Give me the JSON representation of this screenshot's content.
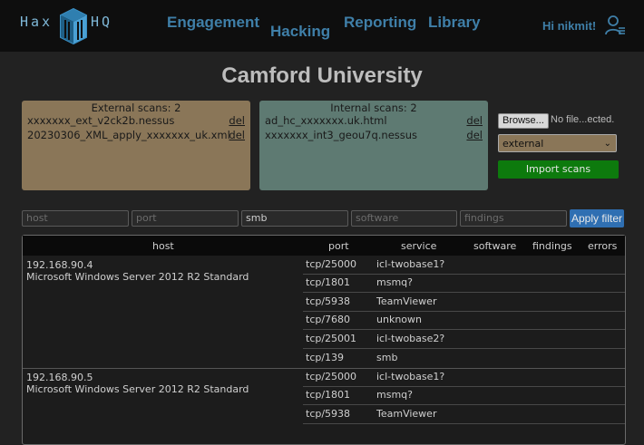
{
  "logo": {
    "left": "Hax",
    "right": "HQ"
  },
  "nav": {
    "engagement": "Engagement",
    "hacking": "Hacking",
    "reporting": "Reporting",
    "library": "Library"
  },
  "user": {
    "greeting": "Hi nikmit!"
  },
  "page": {
    "title": "Camford University"
  },
  "external_scans": {
    "header": "External scans: 2",
    "items": [
      {
        "name": "xxxxxxx_ext_v2ck2b.nessus",
        "del": "del"
      },
      {
        "name": "20230306_XML_apply_xxxxxxx_uk.xml",
        "del": "del"
      }
    ]
  },
  "internal_scans": {
    "header": "Internal scans: 2",
    "items": [
      {
        "name": "ad_hc_xxxxxxx.uk.html",
        "del": "del"
      },
      {
        "name": "xxxxxxx_int3_geou7q.nessus",
        "del": "del"
      }
    ]
  },
  "upload": {
    "browse": "Browse...",
    "no_file": "No file...ected.",
    "scan_type": "external",
    "import": "Import scans"
  },
  "filters": {
    "host_placeholder": "host",
    "port_placeholder": "port",
    "service_value": "smb",
    "software_placeholder": "software",
    "findings_placeholder": "findings",
    "apply": "Apply filter"
  },
  "table": {
    "headers": {
      "host": "host",
      "port": "port",
      "service": "service",
      "software": "software",
      "findings": "findings",
      "errors": "errors"
    },
    "hosts": [
      {
        "ip": "192.168.90.4",
        "os": "Microsoft Windows Server 2012 R2 Standard",
        "services": [
          {
            "port": "tcp/25000",
            "service": "icl-twobase1?"
          },
          {
            "port": "tcp/1801",
            "service": "msmq?"
          },
          {
            "port": "tcp/5938",
            "service": "TeamViewer"
          },
          {
            "port": "tcp/7680",
            "service": "unknown"
          },
          {
            "port": "tcp/25001",
            "service": "icl-twobase2?"
          },
          {
            "port": "tcp/139",
            "service": "smb"
          }
        ]
      },
      {
        "ip": "192.168.90.5",
        "os": "Microsoft Windows Server 2012 R2 Standard",
        "services": [
          {
            "port": "tcp/25000",
            "service": "icl-twobase1?"
          },
          {
            "port": "tcp/1801",
            "service": "msmq?"
          },
          {
            "port": "tcp/5938",
            "service": "TeamViewer"
          }
        ]
      }
    ]
  }
}
